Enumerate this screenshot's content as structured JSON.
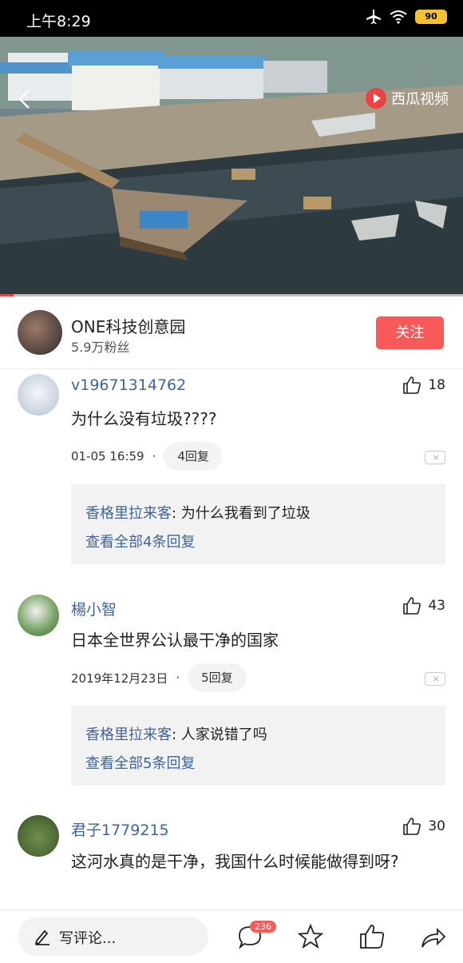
{
  "status_bar": {
    "time": "上午8:29",
    "battery": "90"
  },
  "video": {
    "brand": "西瓜视频",
    "progress": 0.03,
    "colors": {
      "accent": "#f04142"
    }
  },
  "author": {
    "name": "ONE科技创意园",
    "fans": "5.9万粉丝",
    "follow_label": "关注"
  },
  "comments": [
    {
      "user": "v19671314762",
      "likes": "18",
      "text": "为什么没有垃圾????",
      "date": "01-05 16:59",
      "reply_count_label": "4回复",
      "reply_preview_user": "香格里拉来客",
      "reply_preview_text": ": 为什么我看到了垃圾",
      "view_all": "查看全部4条回复"
    },
    {
      "user": "楊小智",
      "likes": "43",
      "text": "日本全世界公认最干净的国家",
      "date": "2019年12月23日",
      "reply_count_label": "5回复",
      "reply_preview_user": "香格里拉来客",
      "reply_preview_text": ": 人家说错了吗",
      "view_all": "查看全部5条回复"
    },
    {
      "user": "君子1779215",
      "likes": "30",
      "text": "这河水真的是干净，我国什么时候能做得到呀?"
    }
  ],
  "bottom_bar": {
    "write_placeholder": "写评论...",
    "comment_badge": "236"
  },
  "colors": {
    "link_blue": "#406599",
    "follow_red": "#f85959"
  }
}
